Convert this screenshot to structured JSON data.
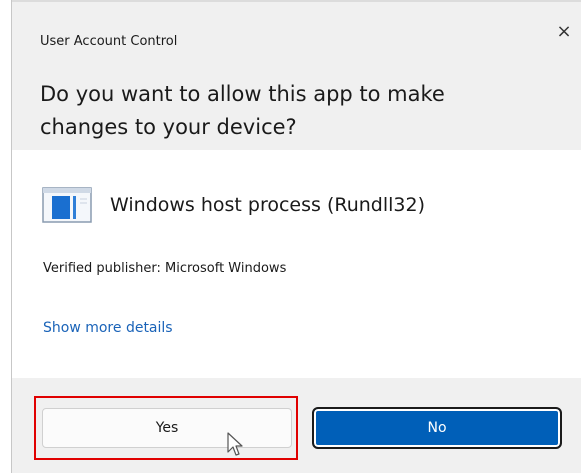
{
  "window": {
    "title": "User Account Control",
    "close_label": "×"
  },
  "prompt": {
    "question": "Do you want to allow this app to make changes to your device?"
  },
  "app": {
    "name": "Windows host process (Rundll32)",
    "icon": "window-app-icon"
  },
  "publisher": {
    "text": "Verified publisher: Microsoft Windows"
  },
  "details_link": {
    "label": "Show more details"
  },
  "buttons": {
    "yes_label": "Yes",
    "no_label": "No"
  },
  "colors": {
    "primary_button": "#005fb8",
    "link": "#1a63b8",
    "highlight": "#e00000"
  }
}
